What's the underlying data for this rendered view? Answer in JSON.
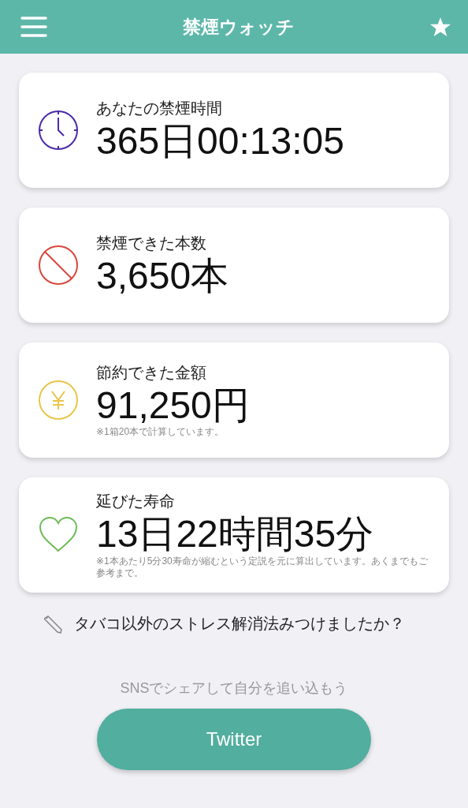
{
  "header": {
    "title": "禁煙ウォッチ"
  },
  "cards": [
    {
      "kind": "clock",
      "color": "#4b2aa8",
      "label": "あなたの禁煙時間",
      "value": "365日00:13:05"
    },
    {
      "kind": "ban",
      "color": "#d9463c",
      "label": "禁煙できた本数",
      "value": "3,650本"
    },
    {
      "kind": "yen",
      "color": "#e9c54a",
      "label": "節約できた金額",
      "value": "91,250円",
      "note": "※1箱20本で計算しています。"
    },
    {
      "kind": "heart",
      "color": "#6dbb57",
      "label": "延びた寿命",
      "value": "13日22時間35分",
      "note": "※1本あたり5分30寿命が縮むという定説を元に算出しています。あくまでもご参考まで。"
    }
  ],
  "tip_link": "タバコ以外のストレス解消法みつけましたか？",
  "share": {
    "caption": "SNSでシェアして自分を追い込もう",
    "button": "Twitter"
  }
}
